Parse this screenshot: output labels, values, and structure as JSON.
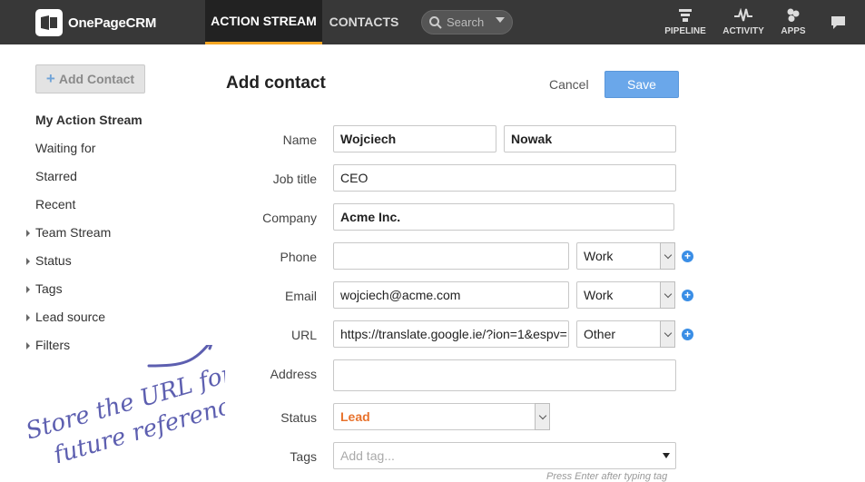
{
  "app": {
    "name": "OnePageCRM"
  },
  "nav": {
    "tabs": [
      {
        "label": "ACTION STREAM"
      },
      {
        "label": "CONTACTS"
      }
    ],
    "search_placeholder": "Search",
    "right": [
      {
        "label": "PIPELINE",
        "icon": "filter-icon"
      },
      {
        "label": "ACTIVITY",
        "icon": "pulse-icon"
      },
      {
        "label": "APPS",
        "icon": "apps-icon"
      }
    ]
  },
  "sidebar": {
    "add_button": "Add Contact",
    "items": [
      {
        "label": "My Action Stream"
      },
      {
        "label": "Waiting for"
      },
      {
        "label": "Starred"
      },
      {
        "label": "Recent"
      },
      {
        "label": "Team Stream"
      },
      {
        "label": "Status"
      },
      {
        "label": "Tags"
      },
      {
        "label": "Lead source"
      },
      {
        "label": "Filters"
      }
    ]
  },
  "form": {
    "title": "Add contact",
    "cancel_label": "Cancel",
    "save_label": "Save",
    "labels": {
      "name": "Name",
      "job_title": "Job title",
      "company": "Company",
      "phone": "Phone",
      "email": "Email",
      "url": "URL",
      "address": "Address",
      "status": "Status",
      "tags": "Tags"
    },
    "first_name": "Wojciech",
    "last_name": "Nowak",
    "job_title": "CEO",
    "company": "Acme Inc.",
    "phone": "",
    "phone_type": "Work",
    "email": "wojciech@acme.com",
    "email_type": "Work",
    "url": "https://translate.google.ie/?ion=1&espv=",
    "url_type": "Other",
    "address": "",
    "status": "Lead",
    "tags_placeholder": "Add tag...",
    "tags_hint": "Press Enter after typing tag"
  },
  "annotation": {
    "line1": "Store the URL for",
    "line2": "future reference"
  },
  "colors": {
    "topbar": "#383838",
    "accent": "#f5a623",
    "save": "#6aa7ea",
    "status": "#e8722c",
    "annotation": "#5d5fb0"
  }
}
